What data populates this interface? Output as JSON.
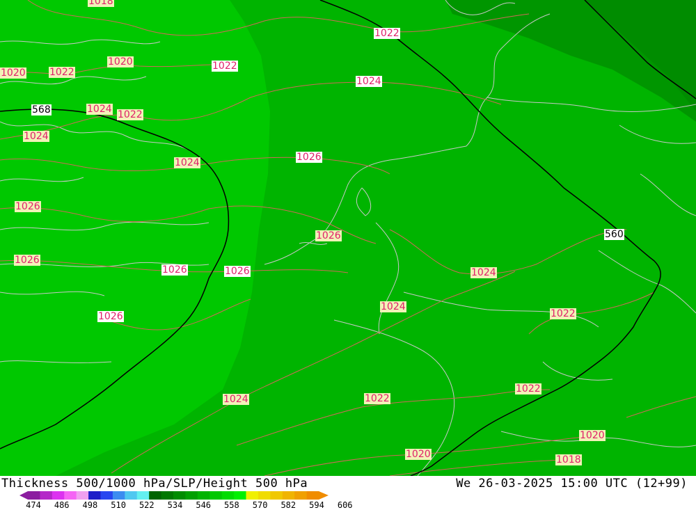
{
  "title": "Thickness 500/1000 hPa/SLP/Height 500 hPa",
  "datetime": "We 26-03-2025 15:00 UTC (12+99)",
  "colors": {
    "zone_light": "#00c800",
    "zone_mid": "#00b400",
    "zone_dark": "#009600",
    "zone_darker": "#008c00",
    "isobar": "#d06a5a",
    "height_contour": "#000000",
    "coastline": "#c8c8c8",
    "slp_label_bg": "#f2f2b8",
    "slp_label_text": "#e0206a"
  },
  "isobar_labels": [
    "1018",
    "1020",
    "1022",
    "1020",
    "1022",
    "1022",
    "1024",
    "1024",
    "1022",
    "1024",
    "1024",
    "1026",
    "1026",
    "1026",
    "1026",
    "1026",
    "1026",
    "1024",
    "1024",
    "1022",
    "1024",
    "1022",
    "1022",
    "1020",
    "1020",
    "1018"
  ],
  "height_labels": [
    "568",
    "560"
  ],
  "scale": {
    "ticks": [
      "474",
      "486",
      "498",
      "510",
      "522",
      "534",
      "546",
      "558",
      "570",
      "582",
      "594",
      "606"
    ],
    "colors": [
      "#8c1ea0",
      "#b428c8",
      "#dc32f0",
      "#f564f5",
      "#f0a0f0",
      "#1e1ec8",
      "#2846f0",
      "#3c8cf0",
      "#50c8f0",
      "#64f0f0",
      "#006400",
      "#007800",
      "#008c00",
      "#00a000",
      "#00b400",
      "#00c800",
      "#00dc00",
      "#00f000",
      "#f0f000",
      "#f0dc00",
      "#f0c800",
      "#f0b400",
      "#f0a000",
      "#f08c00"
    ]
  }
}
